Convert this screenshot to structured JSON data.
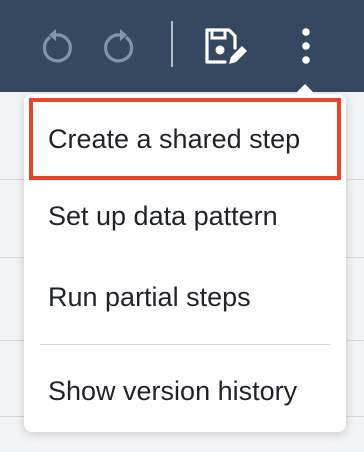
{
  "toolbar": {
    "undo_icon": "undo-icon",
    "redo_icon": "redo-icon",
    "save_icon": "save-edit-icon",
    "more_icon": "more-vertical-icon",
    "colors": {
      "bar": "#354860",
      "icon_dim": "#8394a7",
      "icon_bright": "#ffffff"
    }
  },
  "menu": {
    "items": [
      {
        "label": "Create a shared step",
        "highlighted": true
      },
      {
        "label": "Set up data pattern"
      },
      {
        "label": "Run partial steps"
      },
      {
        "label": "Show version history"
      }
    ],
    "highlight_color": "#e8442a"
  }
}
